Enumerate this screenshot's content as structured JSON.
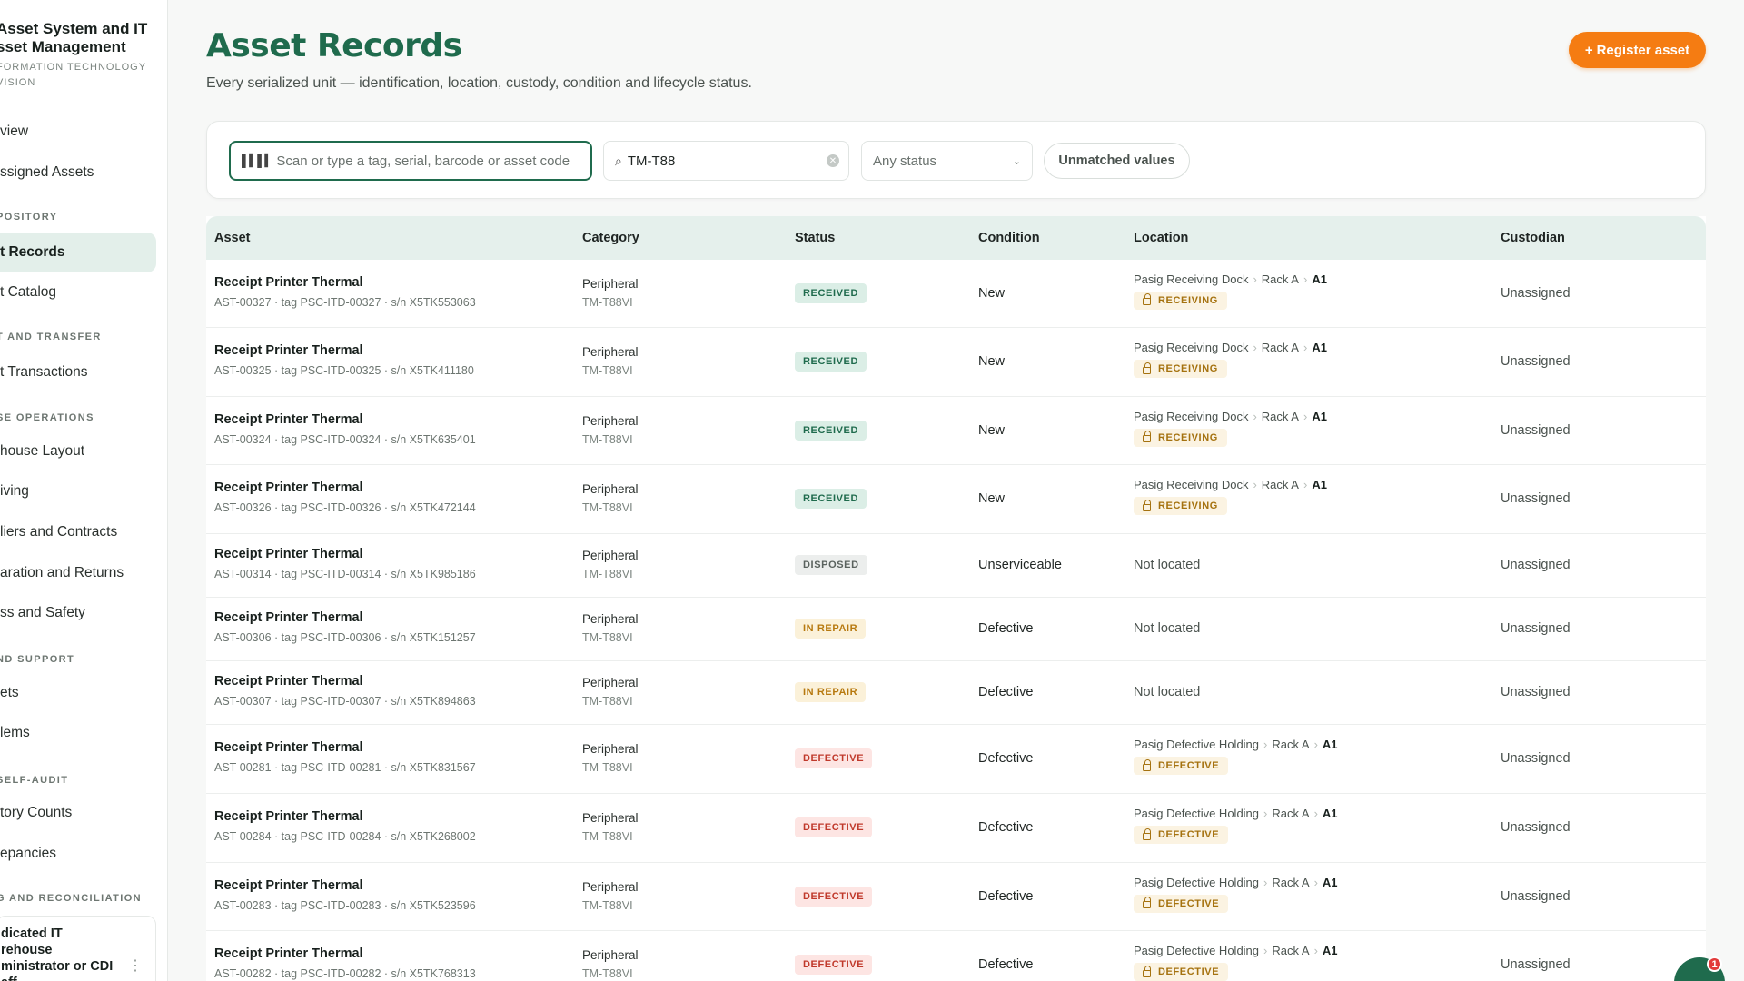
{
  "sidebar": {
    "brand_title_1": "Asset System and IT",
    "brand_title_2": "sset Management",
    "brand_sub_1": "FORMATION TECHNOLOGY",
    "brand_sub_2": "VISION",
    "items": {
      "overview": "view",
      "assigned": "ssigned Assets",
      "repository_section": "POSITORY",
      "asset_records": "t Records",
      "asset_catalog": "t Catalog",
      "transfer_section": "T AND TRANSFER",
      "asset_transactions": "t Transactions",
      "warehouse_section": "SE OPERATIONS",
      "warehouse_layout": "house Layout",
      "receiving": "iving",
      "suppliers": "liers and Contracts",
      "separation": "aration and Returns",
      "safety": "ss and Safety",
      "support_section": "ND SUPPORT",
      "tickets": "ets",
      "problems": "lems",
      "audit_section": "SELF-AUDIT",
      "inventory_counts": "tory Counts",
      "discrepancies": "epancies",
      "reconciliation_section": "G AND RECONCILIATION"
    },
    "user": {
      "line1": "dicated IT",
      "line2": "rehouse",
      "line3": "ministrator or CDI",
      "line4": "aff",
      "menu_icon": "more-vertical-icon"
    }
  },
  "header": {
    "title": "Asset Records",
    "subtitle": "Every serialized unit — identification, location, custody, condition and lifecycle status.",
    "register_label": "Register asset"
  },
  "filters": {
    "scan_placeholder": "Scan or type a tag, serial, barcode or asset code",
    "search_value": "TM-T88",
    "status_value": "Any status",
    "unmatched_label": "Unmatched values"
  },
  "table": {
    "headers": {
      "asset": "Asset",
      "category": "Category",
      "status": "Status",
      "condition": "Condition",
      "location": "Location",
      "custodian": "Custodian"
    },
    "rows": [
      {
        "name": "Receipt Printer Thermal",
        "meta": "AST-00327 · tag PSC-ITD-00327 · s/n X5TK553063",
        "category": "Peripheral",
        "model": "TM-T88VI",
        "status": "RECEIVED",
        "condition": "New",
        "loc_site": "Pasig Receiving Dock",
        "loc_rack": "Rack A",
        "loc_bin": "A1",
        "loc_tag": "RECEIVING",
        "custodian": "Unassigned"
      },
      {
        "name": "Receipt Printer Thermal",
        "meta": "AST-00325 · tag PSC-ITD-00325 · s/n X5TK411180",
        "category": "Peripheral",
        "model": "TM-T88VI",
        "status": "RECEIVED",
        "condition": "New",
        "loc_site": "Pasig Receiving Dock",
        "loc_rack": "Rack A",
        "loc_bin": "A1",
        "loc_tag": "RECEIVING",
        "custodian": "Unassigned"
      },
      {
        "name": "Receipt Printer Thermal",
        "meta": "AST-00324 · tag PSC-ITD-00324 · s/n X5TK635401",
        "category": "Peripheral",
        "model": "TM-T88VI",
        "status": "RECEIVED",
        "condition": "New",
        "loc_site": "Pasig Receiving Dock",
        "loc_rack": "Rack A",
        "loc_bin": "A1",
        "loc_tag": "RECEIVING",
        "custodian": "Unassigned"
      },
      {
        "name": "Receipt Printer Thermal",
        "meta": "AST-00326 · tag PSC-ITD-00326 · s/n X5TK472144",
        "category": "Peripheral",
        "model": "TM-T88VI",
        "status": "RECEIVED",
        "condition": "New",
        "loc_site": "Pasig Receiving Dock",
        "loc_rack": "Rack A",
        "loc_bin": "A1",
        "loc_tag": "RECEIVING",
        "custodian": "Unassigned"
      },
      {
        "name": "Receipt Printer Thermal",
        "meta": "AST-00314 · tag PSC-ITD-00314 · s/n X5TK985186",
        "category": "Peripheral",
        "model": "TM-T88VI",
        "status": "DISPOSED",
        "condition": "Unserviceable",
        "not_located": "Not located",
        "custodian": "Unassigned"
      },
      {
        "name": "Receipt Printer Thermal",
        "meta": "AST-00306 · tag PSC-ITD-00306 · s/n X5TK151257",
        "category": "Peripheral",
        "model": "TM-T88VI",
        "status": "IN REPAIR",
        "condition": "Defective",
        "not_located": "Not located",
        "custodian": "Unassigned"
      },
      {
        "name": "Receipt Printer Thermal",
        "meta": "AST-00307 · tag PSC-ITD-00307 · s/n X5TK894863",
        "category": "Peripheral",
        "model": "TM-T88VI",
        "status": "IN REPAIR",
        "condition": "Defective",
        "not_located": "Not located",
        "custodian": "Unassigned"
      },
      {
        "name": "Receipt Printer Thermal",
        "meta": "AST-00281 · tag PSC-ITD-00281 · s/n X5TK831567",
        "category": "Peripheral",
        "model": "TM-T88VI",
        "status": "DEFECTIVE",
        "condition": "Defective",
        "loc_site": "Pasig Defective Holding",
        "loc_rack": "Rack A",
        "loc_bin": "A1",
        "loc_tag": "DEFECTIVE",
        "custodian": "Unassigned"
      },
      {
        "name": "Receipt Printer Thermal",
        "meta": "AST-00284 · tag PSC-ITD-00284 · s/n X5TK268002",
        "category": "Peripheral",
        "model": "TM-T88VI",
        "status": "DEFECTIVE",
        "condition": "Defective",
        "loc_site": "Pasig Defective Holding",
        "loc_rack": "Rack A",
        "loc_bin": "A1",
        "loc_tag": "DEFECTIVE",
        "custodian": "Unassigned"
      },
      {
        "name": "Receipt Printer Thermal",
        "meta": "AST-00283 · tag PSC-ITD-00283 · s/n X5TK523596",
        "category": "Peripheral",
        "model": "TM-T88VI",
        "status": "DEFECTIVE",
        "condition": "Defective",
        "loc_site": "Pasig Defective Holding",
        "loc_rack": "Rack A",
        "loc_bin": "A1",
        "loc_tag": "DEFECTIVE",
        "custodian": "Unassigned"
      },
      {
        "name": "Receipt Printer Thermal",
        "meta": "AST-00282 · tag PSC-ITD-00282 · s/n X5TK768313",
        "category": "Peripheral",
        "model": "TM-T88VI",
        "status": "DEFECTIVE",
        "condition": "Defective",
        "loc_site": "Pasig Defective Holding",
        "loc_rack": "Rack A",
        "loc_bin": "A1",
        "loc_tag": "DEFECTIVE",
        "custodian": "Unassigned"
      }
    ]
  },
  "help": {
    "badge_count": "1"
  },
  "colors": {
    "brand_green": "#1f6b4d",
    "accent_orange": "#f57c12",
    "table_header": "#e5f0ec"
  }
}
